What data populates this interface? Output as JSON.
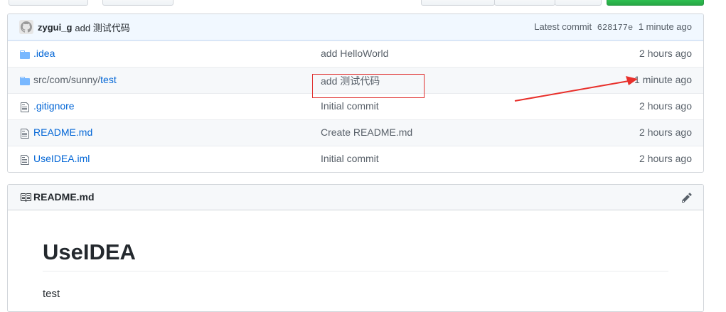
{
  "commit_bar": {
    "author": "zygui_g",
    "message": "add 测试代码",
    "latest_label": "Latest commit",
    "sha": "628177e",
    "time": "1 minute ago"
  },
  "files": [
    {
      "type": "folder",
      "name": ".idea",
      "name_dim": "",
      "message": "add HelloWorld",
      "age": "2 hours ago"
    },
    {
      "type": "folder",
      "name": "test",
      "name_dim": "src/com/sunny/",
      "message": "add 测试代码",
      "age": "1 minute ago"
    },
    {
      "type": "file",
      "name": ".gitignore",
      "name_dim": "",
      "message": "Initial commit",
      "age": "2 hours ago"
    },
    {
      "type": "file",
      "name": "README.md",
      "name_dim": "",
      "message": "Create README.md",
      "age": "2 hours ago"
    },
    {
      "type": "file",
      "name": "UseIDEA.iml",
      "name_dim": "",
      "message": "Initial commit",
      "age": "2 hours ago"
    }
  ],
  "readme": {
    "header_title": "README.md",
    "heading": "UseIDEA",
    "body_text": "test"
  },
  "annotation": {
    "box_color": "#e0302f",
    "arrow_color": "#e8302b"
  }
}
